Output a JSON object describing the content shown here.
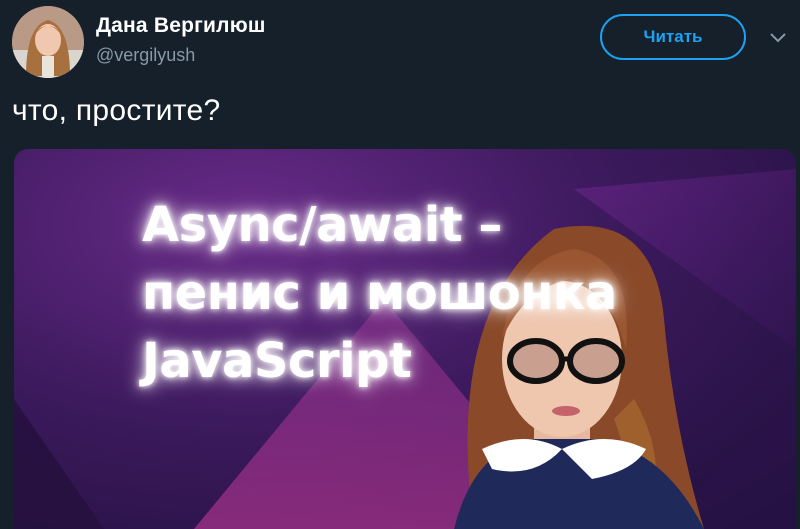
{
  "author": {
    "name": "Дана Вергилюш",
    "handle": "@vergilyush"
  },
  "follow_button": {
    "label": "Читать"
  },
  "tweet": {
    "text": "что, простите?"
  },
  "media": {
    "headline_lines": [
      "Async/await –",
      "пенис и мошонка",
      "JavaScript"
    ]
  },
  "colors": {
    "background": "#15202b",
    "accent": "#1da1f2",
    "secondary_text": "#8899a6",
    "media_purple": "#6a2b8a"
  },
  "icons": {
    "menu": "chevron-down-icon"
  }
}
